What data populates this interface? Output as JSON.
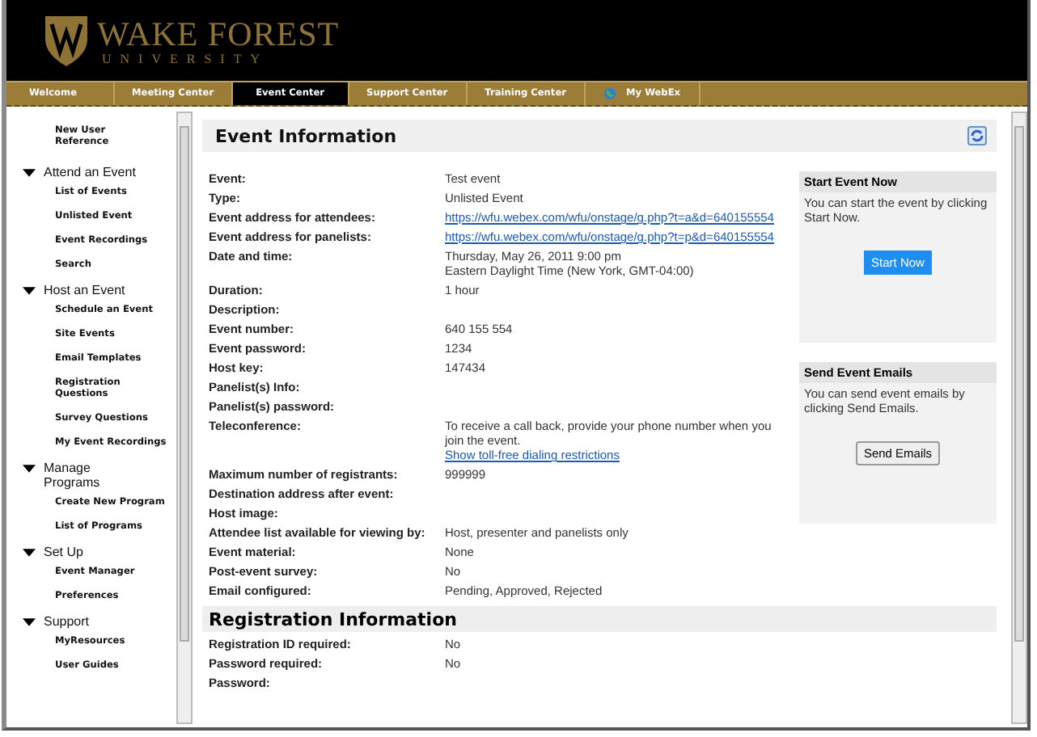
{
  "header": {
    "logo_title": "WAKE FOREST",
    "logo_subtitle": "UNIVERSITY"
  },
  "nav_tabs": [
    {
      "label": "Welcome",
      "selected": false,
      "kind": "plain"
    },
    {
      "label": "Meeting Center",
      "selected": false,
      "kind": "plain"
    },
    {
      "label": "Event Center",
      "selected": true,
      "kind": "plain"
    },
    {
      "label": "Support Center",
      "selected": false,
      "kind": "plain"
    },
    {
      "label": "Training Center",
      "selected": false,
      "kind": "plain"
    },
    {
      "label": "My WebEx",
      "selected": false,
      "kind": "globe"
    }
  ],
  "sidebar": {
    "items": [
      {
        "kind": "link",
        "label": "New User Reference"
      },
      {
        "kind": "section",
        "label": "Attend an Event",
        "expanded": true,
        "children": [
          "List of Events",
          "Unlisted Event",
          "Event Recordings",
          "Search"
        ]
      },
      {
        "kind": "section",
        "label": "Host an Event",
        "expanded": true,
        "children": [
          "Schedule an Event",
          "Site Events",
          "Email Templates",
          "Registration Questions",
          "Survey Questions",
          "My Event Recordings"
        ]
      },
      {
        "kind": "section",
        "label": "Manage Programs",
        "expanded": true,
        "children": [
          "Create New Program",
          "List of Programs"
        ]
      },
      {
        "kind": "section",
        "label": "Set Up",
        "expanded": true,
        "children": [
          "Event Manager",
          "Preferences"
        ]
      },
      {
        "kind": "section",
        "label": "Support",
        "expanded": true,
        "children": [
          "MyResources",
          "User Guides"
        ]
      }
    ]
  },
  "event_info": {
    "title": "Event Information",
    "rows": [
      {
        "label": "Event:",
        "values": [
          {
            "kind": "text",
            "text": "Test event"
          }
        ]
      },
      {
        "label": "Type:",
        "values": [
          {
            "kind": "text",
            "text": "Unlisted Event"
          }
        ]
      },
      {
        "label": "Event address for attendees:",
        "values": [
          {
            "kind": "link",
            "text": "https://wfu.webex.com/wfu/onstage/g.php?t=a&d=640155554"
          }
        ]
      },
      {
        "label": "Event address for panelists:",
        "values": [
          {
            "kind": "link",
            "text": "https://wfu.webex.com/wfu/onstage/g.php?t=p&d=640155554"
          }
        ]
      },
      {
        "label": "Date and time:",
        "values": [
          {
            "kind": "text",
            "text": "Thursday, May 26, 2011 9:00 pm"
          },
          {
            "kind": "text",
            "text": "Eastern Daylight Time (New York, GMT-04:00)"
          }
        ]
      },
      {
        "label": "Duration:",
        "values": [
          {
            "kind": "text",
            "text": "1 hour"
          }
        ]
      },
      {
        "label": "Description:"
      },
      {
        "label": "Event number:",
        "values": [
          {
            "kind": "text",
            "text": "640 155 554"
          }
        ]
      },
      {
        "label": "Event password:",
        "values": [
          {
            "kind": "text",
            "text": "1234"
          }
        ]
      },
      {
        "label": "Host key:",
        "values": [
          {
            "kind": "text",
            "text": "147434"
          }
        ]
      },
      {
        "label": "Panelist(s) Info:"
      },
      {
        "label": "Panelist(s) password:"
      },
      {
        "label": "Teleconference:",
        "values": [
          {
            "kind": "text",
            "text": "To receive a call back, provide your phone number when you join the event."
          },
          {
            "kind": "link",
            "text": "Show toll-free dialing restrictions"
          }
        ]
      },
      {
        "label": "Maximum number of registrants:",
        "values": [
          {
            "kind": "text",
            "text": "999999"
          }
        ]
      },
      {
        "label": "Destination address after event:"
      },
      {
        "label": "Host image:"
      },
      {
        "label": "Attendee list available for viewing by:",
        "values": [
          {
            "kind": "text",
            "text": "Host, presenter and panelists only"
          }
        ]
      },
      {
        "label": "Event material:",
        "values": [
          {
            "kind": "text",
            "text": "None"
          }
        ]
      },
      {
        "label": "Post-event survey:",
        "values": [
          {
            "kind": "text",
            "text": "No"
          }
        ]
      },
      {
        "label": "Email configured:",
        "values": [
          {
            "kind": "text",
            "text": "Pending, Approved, Rejected"
          }
        ]
      }
    ]
  },
  "registration_info": {
    "title": "Registration Information",
    "rows": [
      {
        "label": "Registration ID required:",
        "values": [
          {
            "kind": "text",
            "text": "No"
          }
        ]
      },
      {
        "label": "Password required:",
        "values": [
          {
            "kind": "text",
            "text": "No"
          }
        ]
      },
      {
        "label": "Password:"
      }
    ]
  },
  "side_panels": [
    {
      "title": "Start Event Now",
      "text": "You can start the event by clicking Start Now.",
      "button": "Start Now",
      "kind": "primary"
    },
    {
      "title": "Send Event Emails",
      "text": "You can send event emails by clicking Send Emails.",
      "button": "Send Emails",
      "kind": "secondary"
    }
  ]
}
